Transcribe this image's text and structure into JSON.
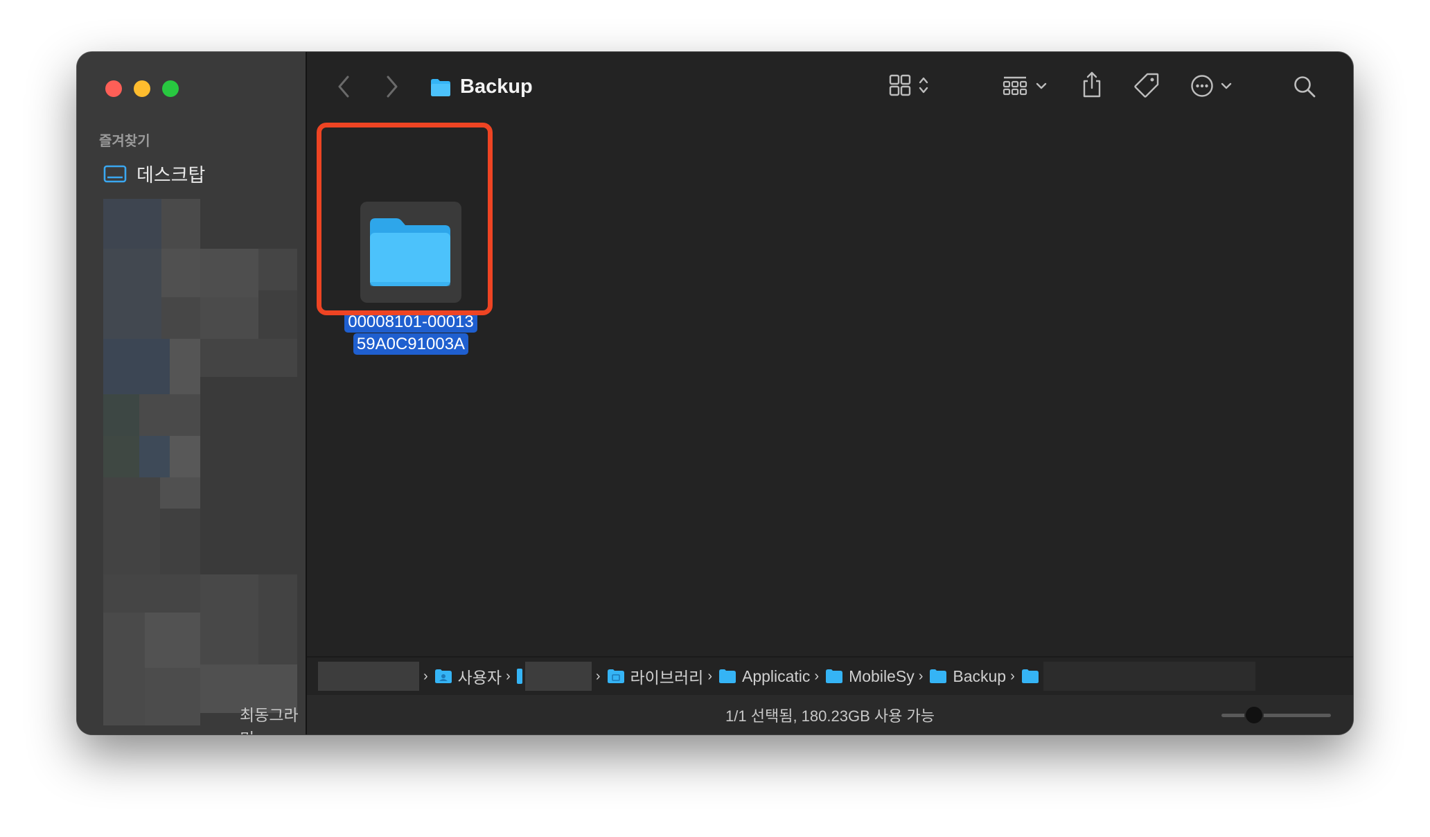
{
  "window": {
    "title": "Backup"
  },
  "sidebar": {
    "section_title": "즐겨찾기",
    "items": [
      {
        "label": "데스크탑",
        "icon": "desktop-icon"
      }
    ],
    "recent_label": "최동그라미"
  },
  "toolbar": {
    "back_icon": "chevron-left-icon",
    "forward_icon": "chevron-right-icon",
    "view_icon": "grid-view-icon",
    "group_icon": "group-by-icon",
    "share_icon": "share-icon",
    "tag_icon": "tag-icon",
    "more_icon": "ellipsis-circle-icon",
    "search_icon": "search-icon"
  },
  "content": {
    "items": [
      {
        "name_line1": "00008101-00013",
        "name_line2": "59A0C91003A",
        "selected": true,
        "icon": "folder-icon"
      }
    ]
  },
  "pathbar": {
    "crumbs": [
      {
        "label": "사용자",
        "icon": "users-folder-icon"
      },
      {
        "label": "라이브러리",
        "icon": "library-folder-icon"
      },
      {
        "label": "Applicatic",
        "icon": "folder-icon"
      },
      {
        "label": "MobileSy",
        "icon": "folder-icon"
      },
      {
        "label": "Backup",
        "icon": "folder-icon"
      }
    ]
  },
  "statusbar": {
    "text": "1/1 선택됨, 180.23GB 사용 가능",
    "zoom_level": 0.3
  },
  "colors": {
    "folder": "#35b4f5",
    "selection": "#1f5fcf",
    "highlight": "#ee4423"
  }
}
